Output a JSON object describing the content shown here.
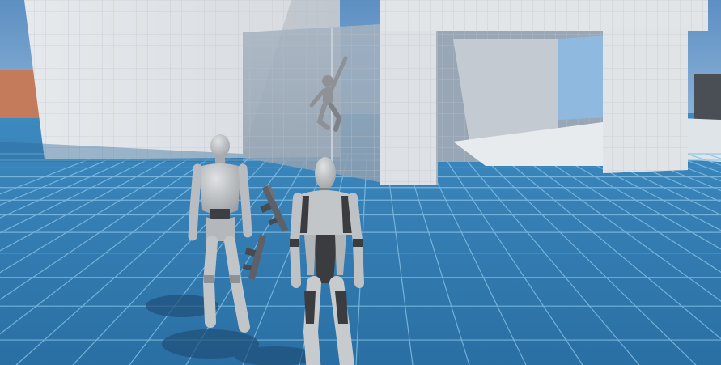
{
  "scene": {
    "description_free": true,
    "colors": {
      "sky_top": "#6a98c8",
      "sky_bottom": "#8fb6db",
      "floor": "#2f79ad",
      "floor_far": "#3a86b8",
      "grid_line": "#8cc6ea",
      "wall": "#e3e6ea",
      "wall_shadow": "#b9c0c8",
      "wall_grid": "#c9cdd2",
      "glass": "#9aa9b8",
      "orange_block": "#c57a5a",
      "dark_block": "#444a52",
      "mannequin_light": "#c8cacd",
      "mannequin_mid": "#9a9da1",
      "mannequin_dark": "#3b3d40"
    },
    "objects": [
      {
        "name": "left-wall",
        "kind": "wall"
      },
      {
        "name": "glass-wall",
        "kind": "transparent-wall"
      },
      {
        "name": "arch-structure",
        "kind": "wall"
      },
      {
        "name": "climbing-mannequin",
        "kind": "character"
      },
      {
        "name": "rear-mannequin",
        "kind": "character"
      },
      {
        "name": "player-mannequin",
        "kind": "character"
      },
      {
        "name": "floating-rifle-upper",
        "kind": "weapon-pickup"
      },
      {
        "name": "floating-rifle-lower",
        "kind": "weapon-pickup"
      }
    ]
  }
}
